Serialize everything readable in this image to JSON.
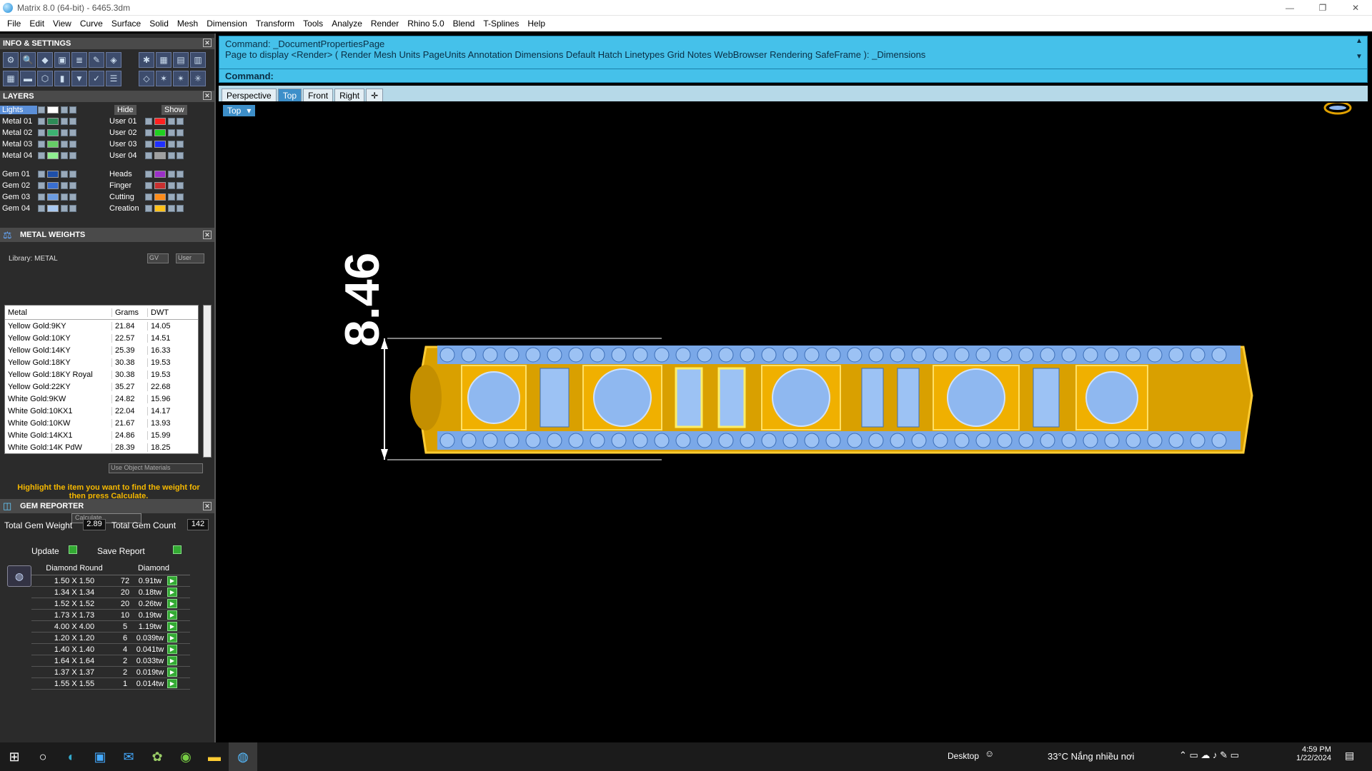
{
  "titlebar": {
    "title": "Matrix 8.0 (64-bit) - 6465.3dm",
    "minimize": "—",
    "restore": "❐",
    "close": "✕"
  },
  "menu": [
    "File",
    "Edit",
    "View",
    "Curve",
    "Surface",
    "Solid",
    "Mesh",
    "Dimension",
    "Transform",
    "Tools",
    "Analyze",
    "Render",
    "Rhino 5.0",
    "Blend",
    "T-Splines",
    "Help"
  ],
  "info_settings": {
    "title": "INFO & SETTINGS"
  },
  "layers": {
    "title": "LAYERS",
    "lights": "Lights",
    "hide": "Hide",
    "show": "Show",
    "left": [
      {
        "name": "Metal 01",
        "color": "#2e8b57"
      },
      {
        "name": "Metal 02",
        "color": "#3cb371"
      },
      {
        "name": "Metal 03",
        "color": "#66cd66"
      },
      {
        "name": "Metal 04",
        "color": "#90ee90"
      },
      {
        "name": "Gem 01",
        "color": "#1e4fa8"
      },
      {
        "name": "Gem 02",
        "color": "#3a6fd0"
      },
      {
        "name": "Gem 03",
        "color": "#6b9be0"
      },
      {
        "name": "Gem 04",
        "color": "#a8c8f0"
      }
    ],
    "right": [
      {
        "name": "User 01",
        "color": "#ff2020"
      },
      {
        "name": "User 02",
        "color": "#20d020"
      },
      {
        "name": "User 03",
        "color": "#2030ff"
      },
      {
        "name": "User 04",
        "color": "#a0a0a0"
      },
      {
        "name": "Heads",
        "color": "#9b30c8"
      },
      {
        "name": "Finger",
        "color": "#c83030"
      },
      {
        "name": "Cutting",
        "color": "#ff8c1a"
      },
      {
        "name": "Creation",
        "color": "#ffc21a"
      }
    ]
  },
  "metal_weights": {
    "title": "METAL WEIGHTS",
    "library": "Library: METAL",
    "gv": "GV",
    "user": "User",
    "headers": [
      "Metal",
      "Grams",
      "DWT"
    ],
    "rows": [
      [
        "Yellow Gold:9KY",
        "21.84",
        "14.05"
      ],
      [
        "Yellow Gold:10KY",
        "22.57",
        "14.51"
      ],
      [
        "Yellow Gold:14KY",
        "25.39",
        "16.33"
      ],
      [
        "Yellow Gold:18KY",
        "30.38",
        "19.53"
      ],
      [
        "Yellow Gold:18KY Royal",
        "30.38",
        "19.53"
      ],
      [
        "Yellow Gold:22KY",
        "35.27",
        "22.68"
      ],
      [
        "White Gold:9KW",
        "24.82",
        "15.96"
      ],
      [
        "White Gold:10KX1",
        "22.04",
        "14.17"
      ],
      [
        "White Gold:10KW",
        "21.67",
        "13.93"
      ],
      [
        "White Gold:14KX1",
        "24.86",
        "15.99"
      ],
      [
        "White Gold:14K PdW",
        "28.39",
        "18.25"
      ]
    ],
    "use_object_materials": "Use Object Materials",
    "hint": "Highlight the item you want to find the weight for then press Calculate.",
    "calculate": "Calculate"
  },
  "gem_reporter": {
    "title": "GEM REPORTER",
    "total_weight_label": "Total Gem Weight",
    "total_weight": "2.89",
    "total_count_label": "Total Gem Count",
    "total_count": "142",
    "update": "Update",
    "save_report": "Save Report",
    "col_shape": "Diamond Round",
    "col_type": "Diamond",
    "rows": [
      [
        "1.50 X 1.50",
        "72",
        "0.91tw"
      ],
      [
        "1.34 X 1.34",
        "20",
        "0.18tw"
      ],
      [
        "1.52 X 1.52",
        "20",
        "0.26tw"
      ],
      [
        "1.73 X 1.73",
        "10",
        "0.19tw"
      ],
      [
        "4.00 X 4.00",
        "5",
        "1.19tw"
      ],
      [
        "1.20 X 1.20",
        "6",
        "0.039tw"
      ],
      [
        "1.40 X 1.40",
        "4",
        "0.041tw"
      ],
      [
        "1.64 X 1.64",
        "2",
        "0.033tw"
      ],
      [
        "1.37 X 1.37",
        "2",
        "0.019tw"
      ],
      [
        "1.55 X 1.55",
        "1",
        "0.014tw"
      ]
    ]
  },
  "command": {
    "line1": "Command: _DocumentPropertiesPage",
    "line2": "Page to display <Render> ( Render  Mesh  Units  PageUnits  Annotation  Dimensions  Default  Hatch  Linetypes  Grid  Notes  WebBrowser  Rendering  SafeFrame ): _Dimensions",
    "prompt": "Command:"
  },
  "viewtabs": [
    "Perspective",
    "Top",
    "Front",
    "Right"
  ],
  "viewport": {
    "label": "Top",
    "dimension": "8.46"
  },
  "taskbar": {
    "desktop": "Desktop",
    "weather": "33°C  Nắng nhiều nơi",
    "time": "4:59 PM",
    "date": "1/22/2024"
  }
}
